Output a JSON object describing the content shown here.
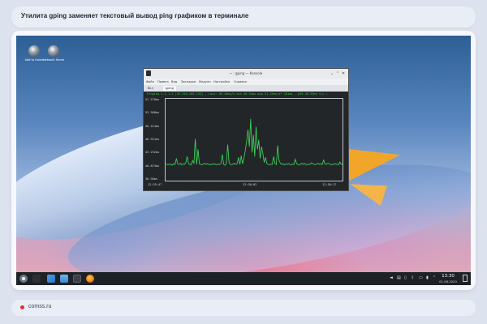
{
  "article": {
    "title": "Утилита gping заменяет текстовый вывод ping графиком в терминале",
    "site": "comss.ru"
  },
  "desktop": {
    "icons": [
      {
        "label": "Add to Home",
        "icon": "globe-icon"
      },
      {
        "label": "Network Home",
        "icon": "globe-icon"
      }
    ]
  },
  "window": {
    "title": "~ : gping — Konsole",
    "menu": [
      "Файл",
      "Правка",
      "Вид",
      "Закладки",
      "Модули",
      "Настройка",
      "Справка"
    ],
    "tabs": [
      "Вкл",
      "gping"
    ],
    "active_tab": "gping",
    "command_line": "Pinging 1.1.1.1 (43.250.169.133) - last: 89.40ms/s min 46.34ms avg 51.49ms/s* 101ms - p95 48.93ms t=/ ✓"
  },
  "chart_data": {
    "type": "line",
    "title": "",
    "xlabel": "",
    "ylabel": "",
    "y_ticks": [
      "57.578ms",
      "53.908ms",
      "50.414ms",
      "46.921ms",
      "43.252ms",
      "40.873ms",
      "36.90ms"
    ],
    "x_ticks": [
      "12:29:47",
      "12:30:02",
      "12:30:17"
    ],
    "ylim": [
      36.9,
      57.578
    ],
    "color": "#3ddc5a",
    "series": [
      {
        "values": [
          41.2,
          41.0,
          40.9,
          41.1,
          41.0,
          40.8,
          41.2,
          41.0,
          42.5,
          41.1,
          41.0,
          41.3,
          40.9,
          41.1,
          41.0,
          41.5,
          43.0,
          41.2,
          41.0,
          40.9,
          42.0,
          41.3,
          47.5,
          41.0,
          44.8,
          41.2,
          41.0,
          40.9,
          41.1,
          41.3,
          41.0,
          41.2,
          41.0,
          40.9,
          41.1,
          41.0,
          41.2,
          41.0,
          40.9,
          41.1,
          41.0,
          41.2,
          43.5,
          41.0,
          40.8,
          41.2,
          46.0,
          41.5,
          41.0,
          40.9,
          41.1,
          41.3,
          41.0,
          41.2,
          42.8,
          41.0,
          43.2,
          41.2,
          42.5,
          44.5,
          46.8,
          49.8,
          45.5,
          52.5,
          44.0,
          48.5,
          43.0,
          50.5,
          44.8,
          47.2,
          42.5,
          45.5,
          43.8,
          41.5,
          42.8,
          41.2,
          41.0,
          40.9,
          41.1,
          41.0,
          43.0,
          41.2,
          41.0,
          45.8,
          42.0,
          41.3,
          41.0,
          41.2,
          40.9,
          41.1,
          41.0,
          41.2,
          41.0,
          40.9,
          41.1,
          41.0,
          42.3,
          41.2,
          41.0,
          40.9,
          41.1,
          41.3,
          41.0,
          41.2,
          41.0,
          40.9,
          41.1,
          41.0,
          41.4,
          41.2,
          41.0,
          40.9,
          41.1,
          41.3,
          41.0,
          41.2,
          41.0,
          42.1,
          41.1,
          41.0,
          41.3,
          41.2,
          41.0,
          40.9,
          41.1,
          41.0,
          41.2,
          41.0,
          40.9,
          41.6,
          41.0,
          41.2
        ]
      }
    ]
  },
  "taskbar": {
    "time": "13:30",
    "date": "01.06.2020",
    "tray_icons": [
      "volume-icon",
      "network-icon",
      "clipboard-icon",
      "bluetooth-icon",
      "notification-icon",
      "battery-icon",
      "expand-tray-icon"
    ]
  }
}
